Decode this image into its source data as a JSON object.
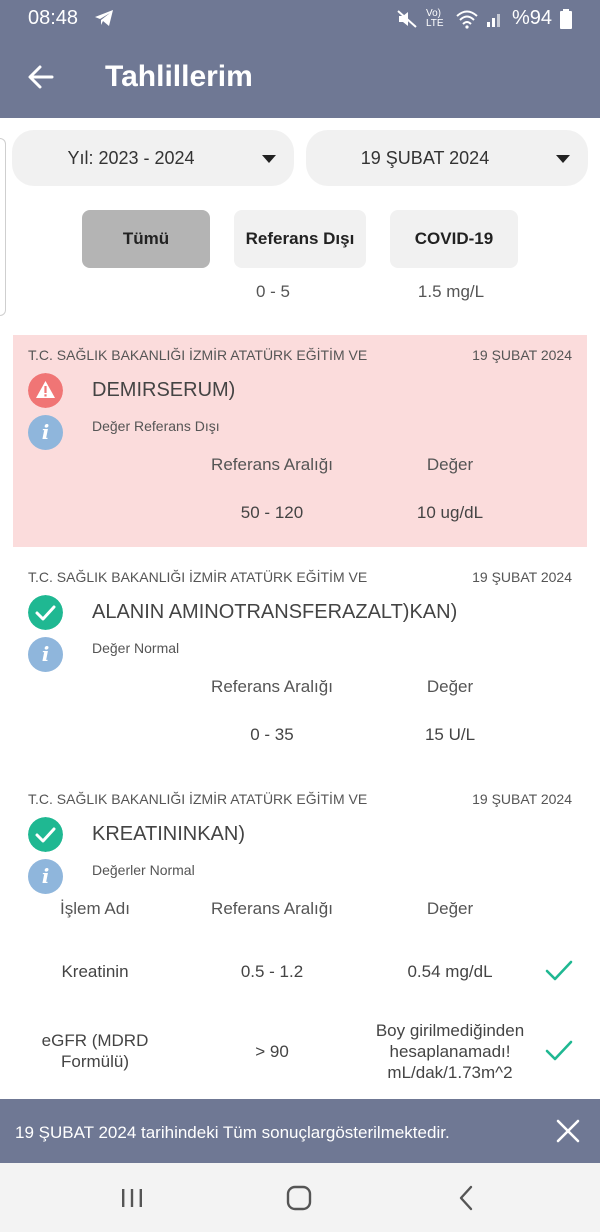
{
  "status_bar": {
    "time": "08:48",
    "battery": "%94",
    "lte_label": "Vo) LTE"
  },
  "header": {
    "title": "Tahlillerim"
  },
  "filters": {
    "year_dropdown": "Yıl: 2023 - 2024",
    "date_dropdown": "19 ŞUBAT 2024",
    "tabs": [
      {
        "label": "Tümü",
        "selected": true
      },
      {
        "label": "Referans Dışı",
        "subtext": "0 - 5"
      },
      {
        "label": "COVID-19",
        "subtext": "1.5 mg/L"
      }
    ]
  },
  "results": [
    {
      "institution": "T.C. SAĞLIK BAKANLIĞI İZMİR ATATÜRK EĞİTİM VE",
      "date": "19 ŞUBAT 2024",
      "test_name": "DEMIRSERUM)",
      "status_icon": "warning-icon",
      "status_text": "Değer Referans Dışı",
      "headers": {
        "range": "Referans Aralığı",
        "value": "Değer"
      },
      "range": "50 - 120",
      "value": "10 ug/dL",
      "color": "#fbdcdc"
    },
    {
      "institution": "T.C. SAĞLIK BAKANLIĞI İZMİR ATATÜRK EĞİTİM VE",
      "date": "19 ŞUBAT 2024",
      "test_name": "ALANIN AMINOTRANSFERAZALT)KAN)",
      "status_icon": "check-circle-icon",
      "status_text": "Değer Normal",
      "headers": {
        "range": "Referans Aralığı",
        "value": "Değer"
      },
      "range": "0 - 35",
      "value": "15 U/L"
    },
    {
      "institution": "T.C. SAĞLIK BAKANLIĞI İZMİR ATATÜRK EĞİTİM VE",
      "date": "19 ŞUBAT 2024",
      "test_name": "KREATININKAN)",
      "status_icon": "check-circle-icon",
      "status_text": "Değerler Normal",
      "headers": {
        "name": "İşlem Adı",
        "range": "Referans Aralığı",
        "value": "Değer"
      },
      "rows": [
        {
          "name": "Kreatinin",
          "range": "0.5 - 1.2",
          "value": "0.54 mg/dL"
        },
        {
          "name_line1": "eGFR (MDRD",
          "name_line2": "Formülü)",
          "range": "> 90",
          "value_line1": "Boy girilmediğinden",
          "value_line2": "hesaplanamadı!",
          "value_line3": "mL/dak/1.73m^2"
        }
      ]
    }
  ],
  "snackbar": {
    "message": "19 ŞUBAT 2024 tarihindeki Tüm sonuçlargösterilmektedir."
  },
  "colors": {
    "primary": "#6f7894",
    "success": "#1fb892",
    "warning": "#f07575",
    "info": "#8fb6dc"
  }
}
